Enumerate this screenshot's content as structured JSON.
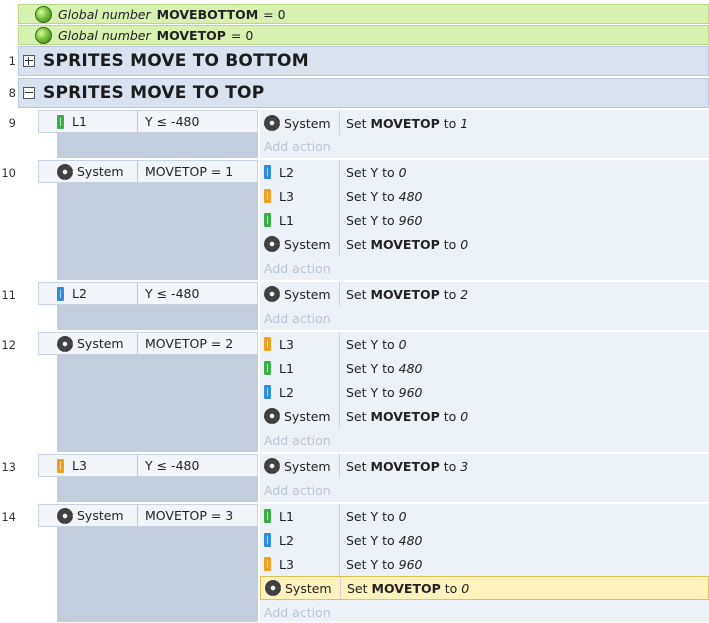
{
  "globals": [
    {
      "type_label": "Global number",
      "name": "MOVEBOTTOM",
      "value": "= 0"
    },
    {
      "type_label": "Global number",
      "name": "MOVETOP",
      "value": "= 0"
    }
  ],
  "groups": [
    {
      "line": "1",
      "title": "SPRITES MOVE TO BOTTOM",
      "collapsed": true
    },
    {
      "line": "8",
      "title": "SPRITES MOVE TO TOP",
      "collapsed": false
    }
  ],
  "events": [
    {
      "line": "9",
      "cond_obj": "L1",
      "cond_icon": "sprite-green-icon",
      "cond_val": "Y ≤ -480",
      "actions": [
        {
          "obj": "System",
          "pre": "Set ",
          "bold": "MOVETOP",
          "mid": " to ",
          "ital": "1"
        }
      ]
    },
    {
      "line": "10",
      "cond_obj": "System",
      "cond_icon": "gear-icon",
      "cond_val": "MOVETOP = 1",
      "actions": [
        {
          "obj": "L2",
          "pre": "Set Y to ",
          "ital": "0"
        },
        {
          "obj": "L3",
          "pre": "Set Y to ",
          "ital": "480"
        },
        {
          "obj": "L1",
          "pre": "Set Y to ",
          "ital": "960"
        },
        {
          "obj": "System",
          "pre": "Set ",
          "bold": "MOVETOP",
          "mid": " to ",
          "ital": "0"
        }
      ]
    },
    {
      "line": "11",
      "cond_obj": "L2",
      "cond_icon": "sprite-blue-icon",
      "cond_val": "Y ≤ -480",
      "actions": [
        {
          "obj": "System",
          "pre": "Set ",
          "bold": "MOVETOP",
          "mid": " to ",
          "ital": "2"
        }
      ]
    },
    {
      "line": "12",
      "cond_obj": "System",
      "cond_icon": "gear-icon",
      "cond_val": "MOVETOP = 2",
      "actions": [
        {
          "obj": "L3",
          "pre": "Set Y to ",
          "ital": "0"
        },
        {
          "obj": "L1",
          "pre": "Set Y to ",
          "ital": "480"
        },
        {
          "obj": "L2",
          "pre": "Set Y to ",
          "ital": "960"
        },
        {
          "obj": "System",
          "pre": "Set ",
          "bold": "MOVETOP",
          "mid": " to ",
          "ital": "0"
        }
      ]
    },
    {
      "line": "13",
      "cond_obj": "L3",
      "cond_icon": "sprite-orange-icon",
      "cond_val": "Y ≤ -480",
      "actions": [
        {
          "obj": "System",
          "pre": "Set ",
          "bold": "MOVETOP",
          "mid": " to ",
          "ital": "3"
        }
      ]
    },
    {
      "line": "14",
      "cond_obj": "System",
      "cond_icon": "gear-icon",
      "cond_val": "MOVETOP = 3",
      "actions": [
        {
          "obj": "L1",
          "pre": "Set Y to ",
          "ital": "0"
        },
        {
          "obj": "L2",
          "pre": "Set Y to ",
          "ital": "480"
        },
        {
          "obj": "L3",
          "pre": "Set Y to ",
          "ital": "960"
        },
        {
          "obj": "System",
          "pre": "Set ",
          "bold": "MOVETOP",
          "mid": " to ",
          "ital": "0"
        }
      ]
    }
  ],
  "add_action_label": "Add action",
  "object_colors": {
    "L1": "#3cae4a",
    "L2": "#2f8fdc",
    "L3": "#f0a020"
  },
  "icons": {
    "global": "globe-icon",
    "system": "gear-icon",
    "sprite": "sprite-icon",
    "group_toggle": "expand-collapse-icon"
  }
}
